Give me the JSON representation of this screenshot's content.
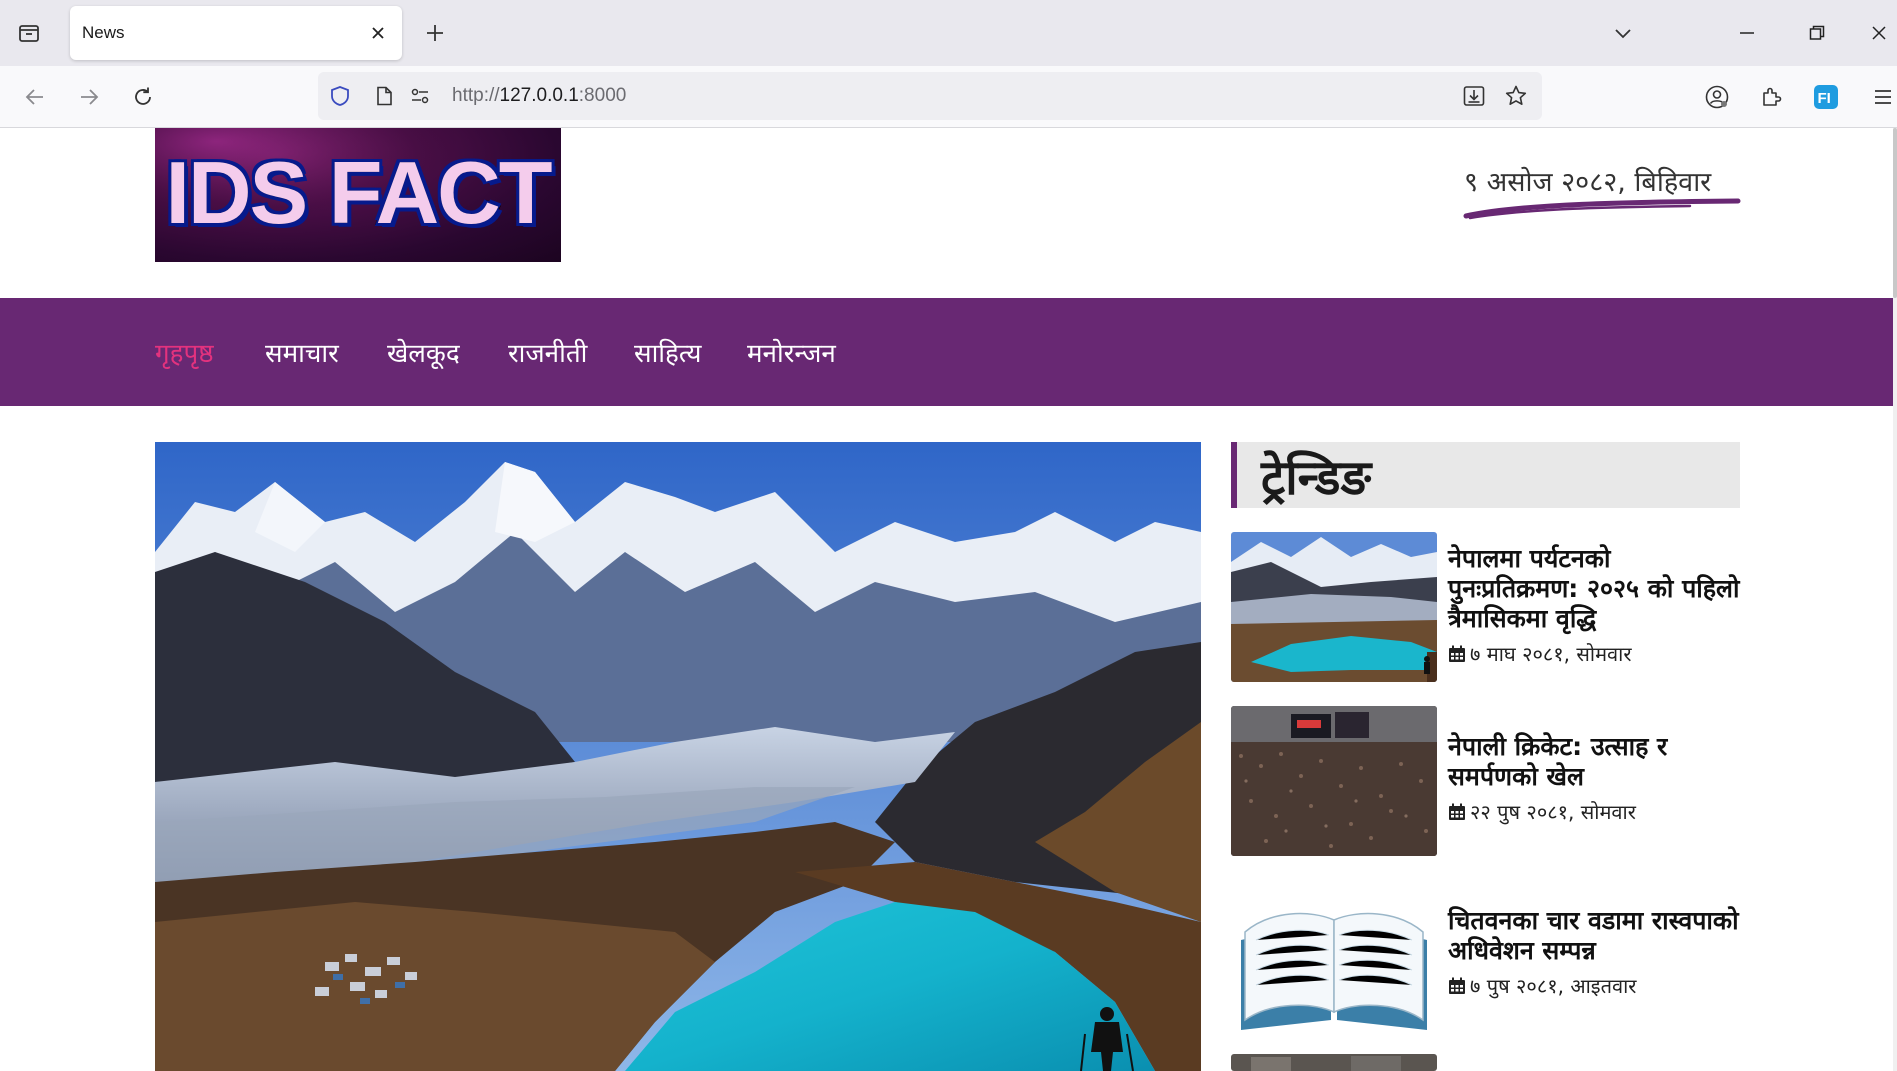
{
  "browser": {
    "tab": {
      "title": "News"
    },
    "url": {
      "scheme": "http://",
      "host": "127.0.0.1",
      "port": ":8000"
    },
    "icons": [
      "tab-list-icon",
      "close-icon",
      "plus-icon",
      "chevron-down-icon",
      "minimize-icon",
      "restore-icon",
      "close-window-icon",
      "back-icon",
      "forward-icon",
      "reload-icon",
      "shield-icon",
      "page-icon",
      "permissions-icon",
      "download-icon",
      "star-icon",
      "account-icon",
      "extensions-icon",
      "extension-fi-icon",
      "menu-icon"
    ]
  },
  "site": {
    "logo_text": "IDS FACT",
    "date": "९ असोज २०८२, बिहिवार",
    "accent_color": "#682873",
    "active_color": "#e3327e"
  },
  "nav": {
    "items": [
      {
        "label": "गृहपृष्ठ",
        "active": true
      },
      {
        "label": "समाचार",
        "active": false
      },
      {
        "label": "खेलकूद",
        "active": false
      },
      {
        "label": "राजनीती",
        "active": false
      },
      {
        "label": "साहित्य",
        "active": false
      },
      {
        "label": "मनोरन्जन",
        "active": false
      }
    ]
  },
  "trending": {
    "heading": "ट्रेन्डिङ",
    "items": [
      {
        "title": "नेपालमा पर्यटनको पुनःप्रतिक्रमण: २०२५ को पहिलो त्रैमासिकमा वृद्धि",
        "date": "७ माघ २०८१, सोमवार",
        "thumb": "mountain-lake"
      },
      {
        "title": "नेपाली क्रिकेट: उत्साह र समर्पणको खेल",
        "date": "२२ पुष २०८१, सोमवार",
        "thumb": "cricket-crowd"
      },
      {
        "title": "चितवनका चार वडामा रास्वपाको अधिवेशन सम्पन्न",
        "date": "७ पुष २०८१, आइतवार",
        "thumb": "open-book"
      }
    ]
  }
}
